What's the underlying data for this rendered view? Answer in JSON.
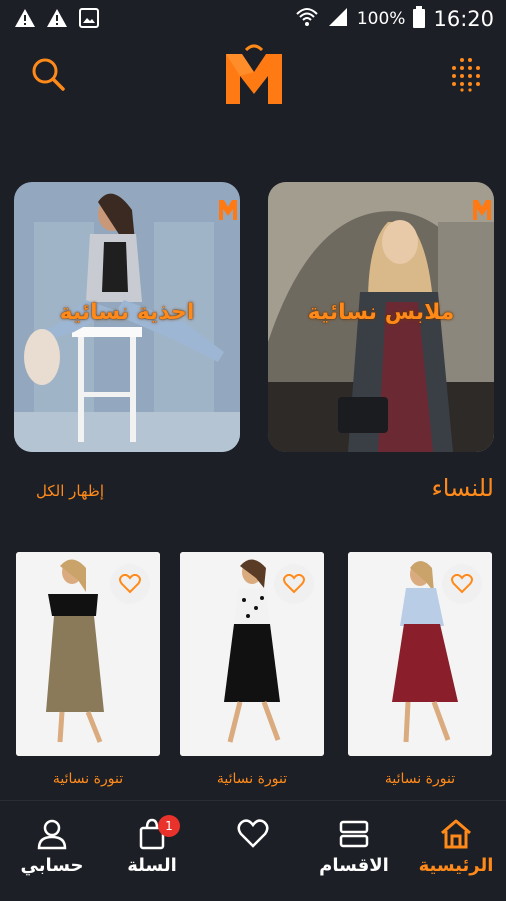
{
  "status_bar": {
    "battery_percent": "100%",
    "time": "16:20"
  },
  "banners": [
    {
      "label": "ملابس نسائية"
    },
    {
      "label": "احذية نسائية"
    }
  ],
  "section": {
    "title": "للنساء",
    "show_all": "إظهار الكل"
  },
  "products": [
    {
      "caption": "تنورة نسائية",
      "skirt_color": "#8a1f2b",
      "top_color": "#b9cde6"
    },
    {
      "caption": "تنورة نسائية",
      "skirt_color": "#111111",
      "top_color": "#f2f2f2"
    },
    {
      "caption": "تنورة نسائية",
      "skirt_color": "#8b7a5a",
      "top_color": "#111111"
    }
  ],
  "bottom_nav": {
    "home": "الرئيسية",
    "categories": "الاقسام",
    "cart": "السلة",
    "cart_badge": "1",
    "account": "حسابي"
  },
  "colors": {
    "accent": "#ff8a1a",
    "background": "#1c1f26",
    "badge": "#e8322b"
  }
}
